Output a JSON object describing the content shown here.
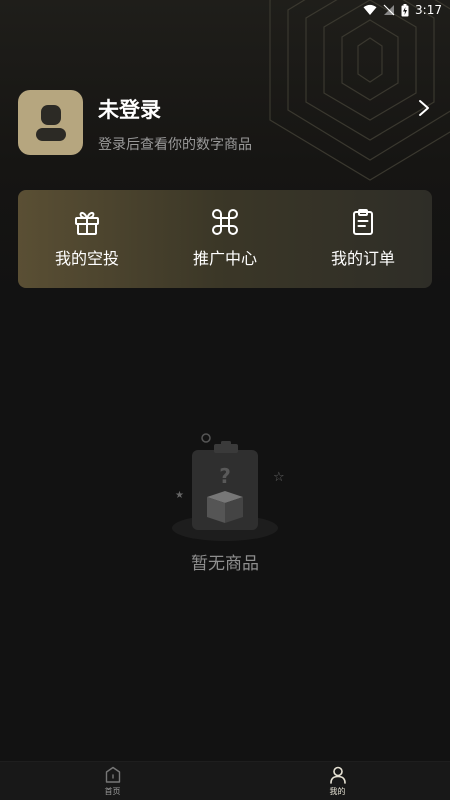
{
  "status_bar": {
    "time": "3:17"
  },
  "profile": {
    "title": "未登录",
    "subtitle": "登录后查看你的数字商品"
  },
  "actions": [
    {
      "label": "我的空投",
      "icon": "gift-icon"
    },
    {
      "label": "推广中心",
      "icon": "command-icon"
    },
    {
      "label": "我的订单",
      "icon": "clipboard-icon"
    }
  ],
  "empty_state": {
    "text": "暂无商品",
    "icon": "empty-box-icon"
  },
  "tabbar": {
    "tabs": [
      {
        "label": "首页",
        "icon": "home-icon",
        "active": false
      },
      {
        "label": "我的",
        "icon": "user-icon",
        "active": true
      }
    ]
  },
  "colors": {
    "accent": "#b6a67f",
    "background": "#121212"
  }
}
